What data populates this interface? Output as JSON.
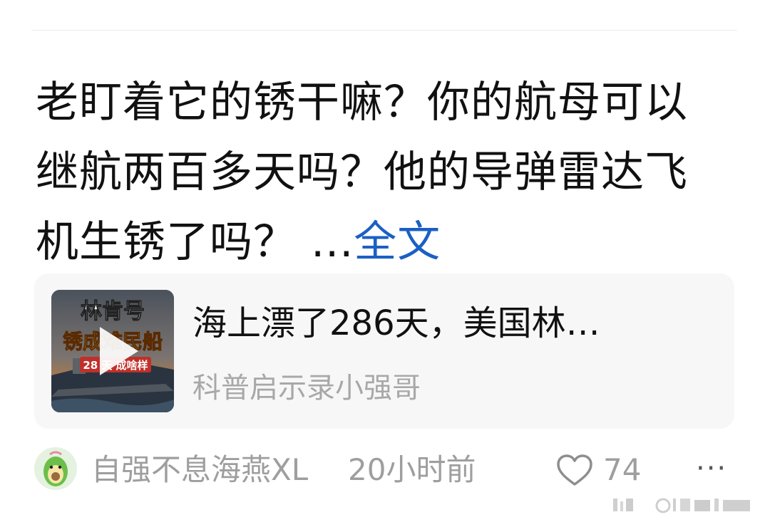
{
  "post": {
    "text": "老盯着它的锈干嘛？你的航母可以继航两百多天吗？他的导弹雷达飞机生锈了吗？ ...",
    "expand_label": "全文"
  },
  "video_card": {
    "title": "海上漂了286天，美国林…",
    "author": "科普启示录小强哥",
    "thumbnail": {
      "overlay_line1": "林肯号",
      "overlay_line2": "锈成难民船",
      "overlay_line3": "28 天 成啥样"
    }
  },
  "footer": {
    "username": "自强不息海燕XL",
    "time": "20小时前",
    "like_count": "74",
    "more_label": "···"
  },
  "colors": {
    "link": "#1b5fc4",
    "muted": "#9e9e9e",
    "card_bg": "#f7f7f8"
  },
  "icons": {
    "play": "play-icon",
    "like": "heart-outline-icon",
    "more": "more-dots-icon"
  }
}
